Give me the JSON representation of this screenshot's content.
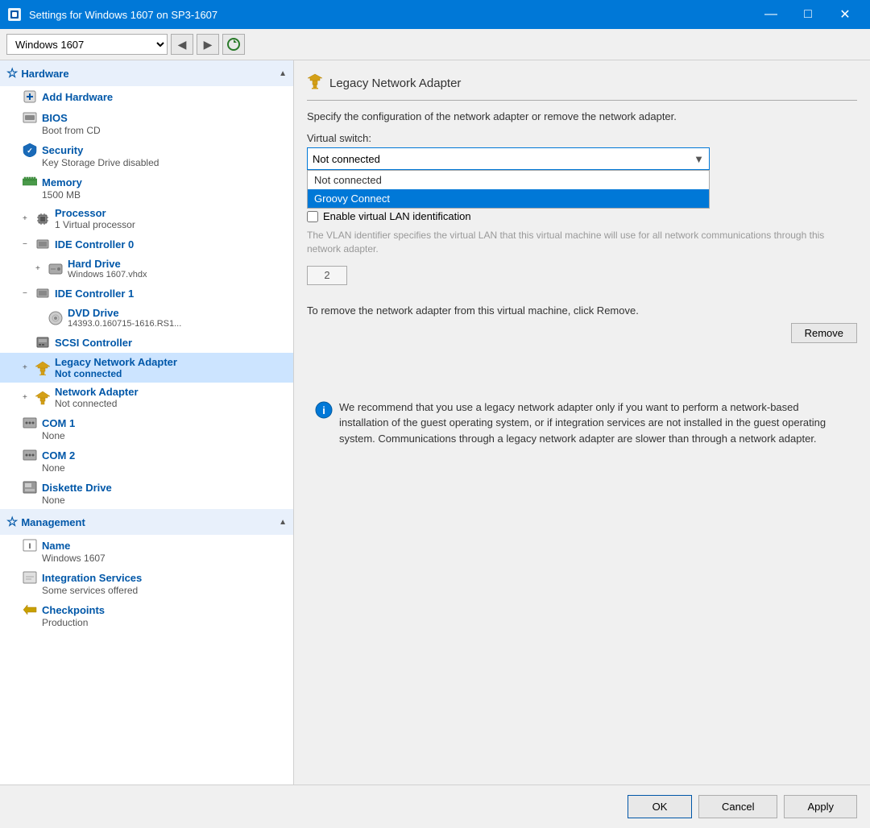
{
  "window": {
    "title": "Settings for Windows 1607 on SP3-1607",
    "icon": "⚙"
  },
  "toolbar": {
    "vm_select_value": "Windows 1607",
    "back_label": "◀",
    "forward_label": "▶",
    "refresh_label": "↻"
  },
  "sidebar": {
    "hardware_section": "Hardware",
    "items": [
      {
        "id": "add-hardware",
        "name": "Add Hardware",
        "sub": "",
        "indent": 1
      },
      {
        "id": "bios",
        "name": "BIOS",
        "sub": "Boot from CD",
        "indent": 1
      },
      {
        "id": "security",
        "name": "Security",
        "sub": "Key Storage Drive disabled",
        "indent": 1
      },
      {
        "id": "memory",
        "name": "Memory",
        "sub": "1500 MB",
        "indent": 1
      },
      {
        "id": "processor",
        "name": "Processor",
        "sub": "1 Virtual processor",
        "indent": 1,
        "expandable": true
      },
      {
        "id": "ide-controller-0",
        "name": "IDE Controller 0",
        "sub": "",
        "indent": 1,
        "expandable": true,
        "expanded": true
      },
      {
        "id": "hard-drive",
        "name": "Hard Drive",
        "sub": "Windows 1607.vhdx",
        "indent": 2,
        "expandable": true
      },
      {
        "id": "ide-controller-1",
        "name": "IDE Controller 1",
        "sub": "",
        "indent": 1,
        "expandable": true,
        "expanded": true
      },
      {
        "id": "dvd-drive",
        "name": "DVD Drive",
        "sub": "14393.0.160715-1616.RS1...",
        "indent": 2
      },
      {
        "id": "scsi-controller",
        "name": "SCSI Controller",
        "sub": "",
        "indent": 1
      },
      {
        "id": "legacy-network-adapter",
        "name": "Legacy Network Adapter",
        "sub": "Not connected",
        "indent": 1,
        "expandable": true,
        "selected": true
      },
      {
        "id": "network-adapter",
        "name": "Network Adapter",
        "sub": "Not connected",
        "indent": 1,
        "expandable": true
      },
      {
        "id": "com1",
        "name": "COM 1",
        "sub": "None",
        "indent": 1
      },
      {
        "id": "com2",
        "name": "COM 2",
        "sub": "None",
        "indent": 1
      },
      {
        "id": "diskette-drive",
        "name": "Diskette Drive",
        "sub": "None",
        "indent": 1
      }
    ],
    "management_section": "Management",
    "mgmt_items": [
      {
        "id": "name",
        "name": "Name",
        "sub": "Windows 1607",
        "indent": 1
      },
      {
        "id": "integration-services",
        "name": "Integration Services",
        "sub": "Some services offered",
        "indent": 1
      },
      {
        "id": "checkpoints",
        "name": "Checkpoints",
        "sub": "Production",
        "indent": 1
      }
    ]
  },
  "panel": {
    "header_icon": "🔌",
    "title": "Legacy Network Adapter",
    "description": "Specify the configuration of the network adapter or remove the network adapter.",
    "virtual_switch_label": "Virtual switch:",
    "dropdown_selected": "Not connected",
    "dropdown_options": [
      {
        "value": "not-connected",
        "label": "Not connected",
        "highlighted": false
      },
      {
        "value": "groovy-connect",
        "label": "Groovy Connect",
        "highlighted": true
      }
    ],
    "enable_vlan_label": "Enable virtual LAN identification",
    "vlan_description": "The VLAN identifier specifies the virtual LAN that this virtual machine will use for all network communications through this network adapter.",
    "vlan_number": "2",
    "remove_text": "To remove the network adapter from this virtual machine, click Remove.",
    "remove_btn_label": "Remove",
    "info_text": "We recommend that you use a legacy network adapter only if you want to perform a network-based installation of the guest operating system, or if integration services are not installed in the guest operating system. Communications through a legacy network adapter are slower than through a network adapter."
  },
  "buttons": {
    "ok": "OK",
    "cancel": "Cancel",
    "apply": "Apply"
  }
}
